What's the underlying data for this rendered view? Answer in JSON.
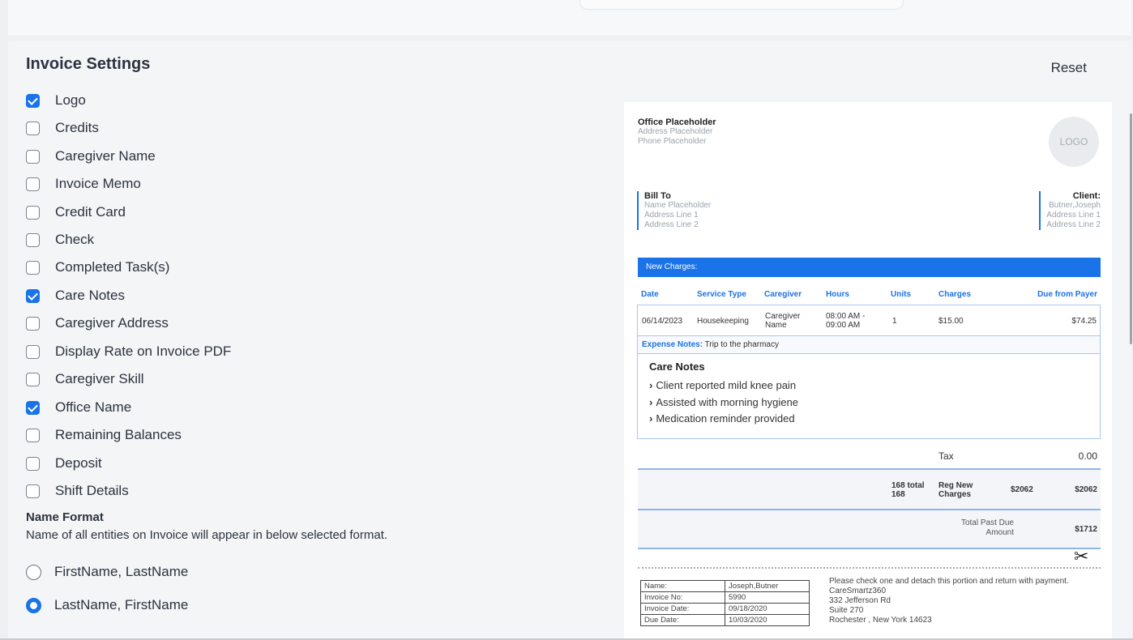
{
  "settings": {
    "title": "Invoice Settings",
    "reset_label": "Reset",
    "options": [
      {
        "label": "Logo",
        "checked": true
      },
      {
        "label": "Credits",
        "checked": false
      },
      {
        "label": "Caregiver Name",
        "checked": false
      },
      {
        "label": "Invoice Memo",
        "checked": false
      },
      {
        "label": "Credit Card",
        "checked": false
      },
      {
        "label": "Check",
        "checked": false
      },
      {
        "label": "Completed Task(s)",
        "checked": false
      },
      {
        "label": "Care Notes",
        "checked": true
      },
      {
        "label": "Caregiver Address",
        "checked": false
      },
      {
        "label": "Display Rate on Invoice PDF",
        "checked": false
      },
      {
        "label": "Caregiver Skill",
        "checked": false
      },
      {
        "label": "Office Name",
        "checked": true
      },
      {
        "label": "Remaining Balances",
        "checked": false
      },
      {
        "label": "Deposit",
        "checked": false
      },
      {
        "label": "Shift Details",
        "checked": false
      }
    ],
    "name_format": {
      "title": "Name Format",
      "description": "Name of all entities on Invoice will appear in below selected format.",
      "options": [
        {
          "label": "FirstName, LastName",
          "selected": false
        },
        {
          "label": "LastName, FirstName",
          "selected": true
        }
      ]
    }
  },
  "invoice": {
    "office_name": "Office Placeholder",
    "office_address": "Address Placeholder",
    "office_phone": "Phone Placeholder",
    "logo_text": "LOGO",
    "bill_to": {
      "title": "Bill To",
      "name": "Name Placeholder",
      "line1": "Address Line 1",
      "line2": "Address Line 2"
    },
    "client": {
      "title": "Client:",
      "name": "Butner,Joseph",
      "line1": "Address Line 1",
      "line2": "Address Line 2"
    },
    "new_charges_label": "New Charges:",
    "columns": {
      "date": "Date",
      "service_type": "Service Type",
      "caregiver": "Caregiver",
      "hours": "Hours",
      "units": "Units",
      "charges": "Charges",
      "due_from_payer": "Due from Payer"
    },
    "row": {
      "date": "06/14/2023",
      "service_type": "Housekeeping",
      "caregiver_line1": "Caregiver",
      "caregiver_line2": "Name",
      "hours_line1": "08:00 AM -",
      "hours_line2": "09:00 AM",
      "units": "1",
      "charges": "$15.00",
      "due_from_payer": "$74.25"
    },
    "expense_label": "Expense Notes:",
    "expense_text": "Trip to the pharmacy",
    "care_notes_title": "Care Notes",
    "care_notes": [
      "Client reported mild knee pain",
      "Assisted with morning hygiene",
      "Medication reminder provided"
    ],
    "tax_label": "Tax",
    "tax_value": "0.00",
    "total_hours_line1": "168 total",
    "total_hours_line2": "168",
    "reg_label_line1": "Reg New",
    "reg_label_line2": "Charges",
    "reg_amount": "$2062",
    "reg_total": "$2062",
    "past_due_line1": "Total Past Due",
    "past_due_line2": "Amount",
    "past_due_value": "$1712",
    "detach": {
      "rows": [
        {
          "label": "Name:",
          "value": "Joseph,Butner"
        },
        {
          "label": "Invoice No:",
          "value": "5990"
        },
        {
          "label": "Invoice Date:",
          "value": "09/18/2020"
        },
        {
          "label": "Due Date:",
          "value": "10/03/2020"
        }
      ],
      "note_line1": "Please check one and detach this portion and return with payment.",
      "company": "CareSmartz360",
      "street": "332 Jefferson Rd",
      "suite": "Suite 270",
      "city": "Rochester , New York 14623"
    }
  },
  "colors": {
    "accent": "#1a73e8",
    "panel": "#f4f5f6"
  }
}
